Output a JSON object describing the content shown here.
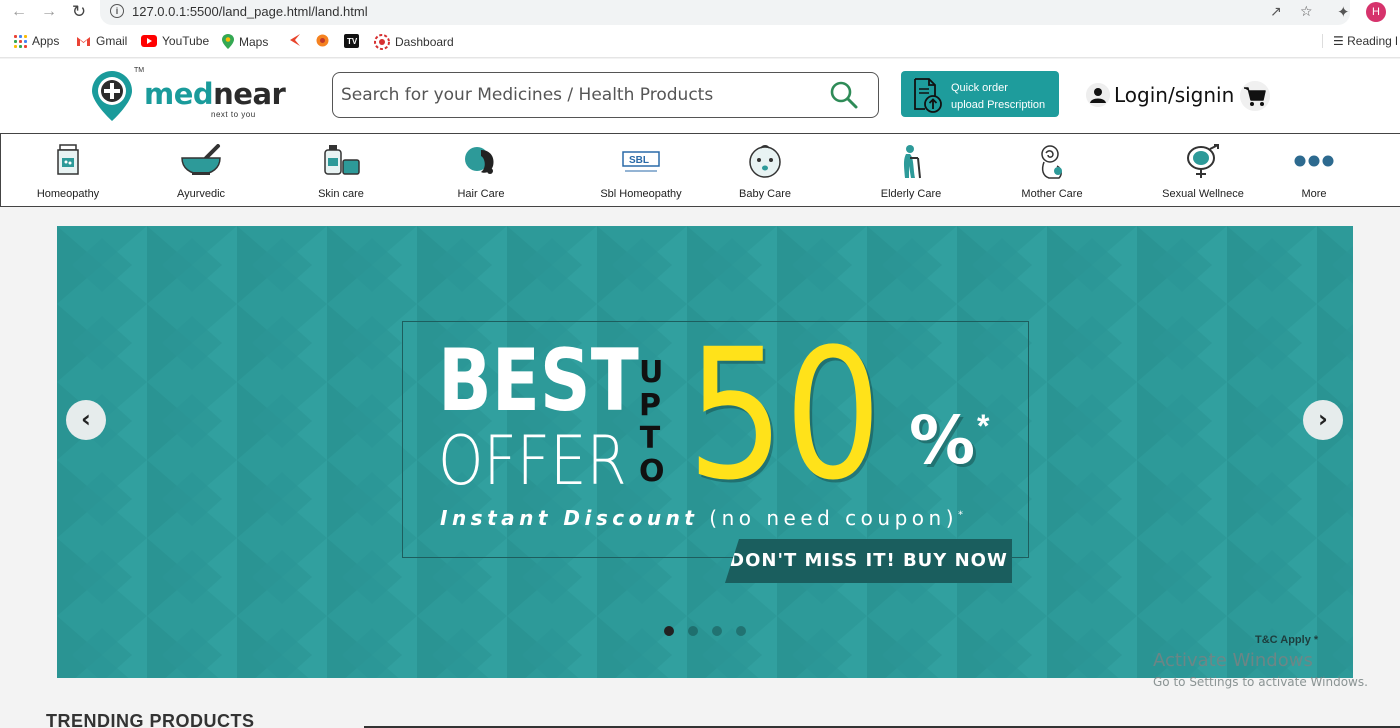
{
  "browser": {
    "url": "127.0.0.1:5500/land_page.html/land.html",
    "profile_initial": "H",
    "bookmarks": [
      {
        "label": "Apps",
        "icon": "apps-icon"
      },
      {
        "label": "Gmail",
        "icon": "gmail-icon"
      },
      {
        "label": "YouTube",
        "icon": "youtube-icon"
      },
      {
        "label": "Maps",
        "icon": "maps-icon"
      },
      {
        "label": "",
        "icon": "bookmark-red-icon"
      },
      {
        "label": "",
        "icon": "bookmark-orange-icon"
      },
      {
        "label": "",
        "icon": "bookmark-tv-icon"
      },
      {
        "label": "Dashboard",
        "icon": "dashboard-icon"
      }
    ],
    "reading_list": "Reading l"
  },
  "header": {
    "logo": {
      "med": "med",
      "near": "near",
      "tagline": "next to you",
      "tm": "TM"
    },
    "search_placeholder": "Search for your Medicines / Health Products",
    "quick_order": {
      "line1": "Quick order",
      "line2": "upload Prescription"
    },
    "login_label": "Login/signin"
  },
  "categories": [
    {
      "label": "Homeopathy",
      "icon": "homeopathy-icon"
    },
    {
      "label": "Ayurvedic",
      "icon": "mortar-pestle-icon"
    },
    {
      "label": "Skin care",
      "icon": "skin-care-icon"
    },
    {
      "label": "Hair Care",
      "icon": "hair-care-icon"
    },
    {
      "label": "Sbl Homeopathy",
      "icon": "sbl-logo-icon"
    },
    {
      "label": "Baby Care",
      "icon": "baby-face-icon"
    },
    {
      "label": "Elderly Care",
      "icon": "elderly-icon"
    },
    {
      "label": "Mother Care",
      "icon": "mother-care-icon"
    },
    {
      "label": "Sexual Wellnece",
      "icon": "gender-icon"
    },
    {
      "label": "More",
      "icon": "more-dots-icon"
    }
  ],
  "banner": {
    "best": "BEST",
    "offer": "OFFER",
    "upto": [
      "U",
      "P",
      "T",
      "O"
    ],
    "value": "50",
    "percent": "%",
    "star": "*",
    "instant_bold": "Instant Discount",
    "instant_rest": "(no need coupon)",
    "cta": "DON'T MISS IT! BUY NOW",
    "tnc": "T&C Apply *",
    "slides": 4,
    "active_slide": 1,
    "colors": {
      "bg": "#2d9a99",
      "accent": "#ffe21a",
      "dark": "#1a5e5e"
    }
  },
  "windows_watermark": {
    "title": "Activate Windows",
    "subtitle": "Go to Settings to activate Windows."
  },
  "trending_title": "TRENDING PRODUCTS"
}
